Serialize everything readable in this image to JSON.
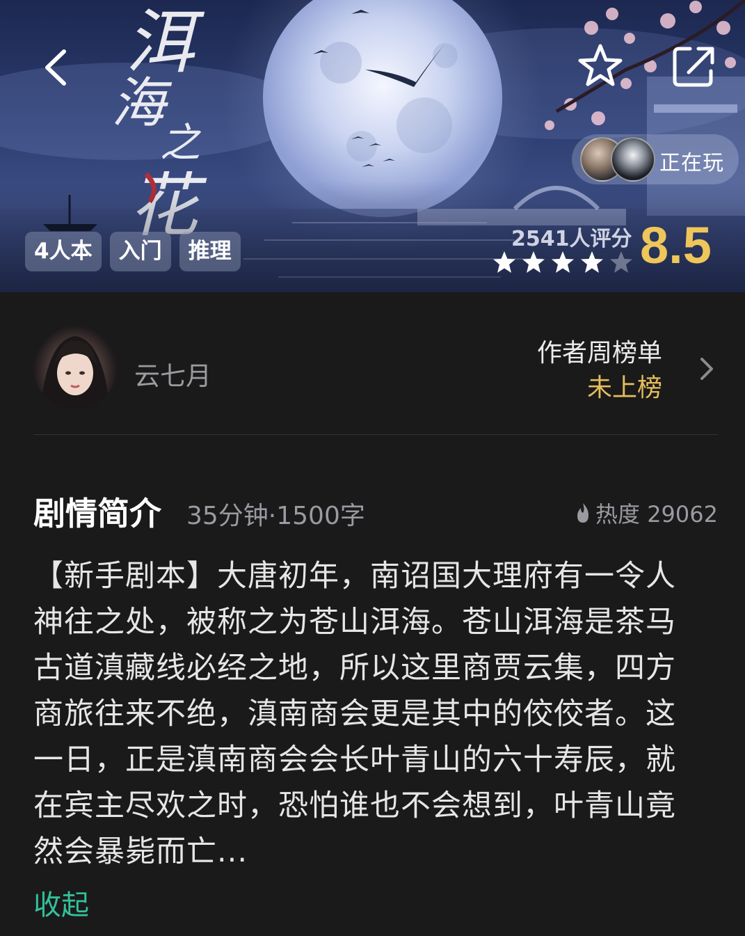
{
  "hero": {
    "title_art": "洱海之花",
    "tags": [
      "4人本",
      "入门",
      "推理"
    ],
    "rating_count": "2541人评分",
    "score": "8.5",
    "stars_filled": 4,
    "stars_total": 5,
    "now_playing_label": "正在玩",
    "score_color": "#efc65a"
  },
  "author": {
    "name": "云七月",
    "rank_title": "作者周榜单",
    "rank_value": "未上榜"
  },
  "synopsis": {
    "heading": "剧情简介",
    "meta": "35分钟·1500字",
    "heat": "热度 29062",
    "body": "【新手剧本】大唐初年，南诏国大理府有一令人神往之处，被称之为苍山洱海。苍山洱海是茶马古道滇藏线必经之地，所以这里商贾云集，四方商旅往来不绝，滇南商会更是其中的佼佼者。这一日，正是滇南商会会长叶青山的六十寿辰，就在宾主尽欢之时，恐怕谁也不会想到，叶青山竟然会暴毙而亡...",
    "collapse_label": "收起",
    "accent_color": "#33c19a"
  },
  "icons": [
    "back-icon",
    "favorite-star-icon",
    "share-icon",
    "chevron-right-icon",
    "flame-icon"
  ]
}
